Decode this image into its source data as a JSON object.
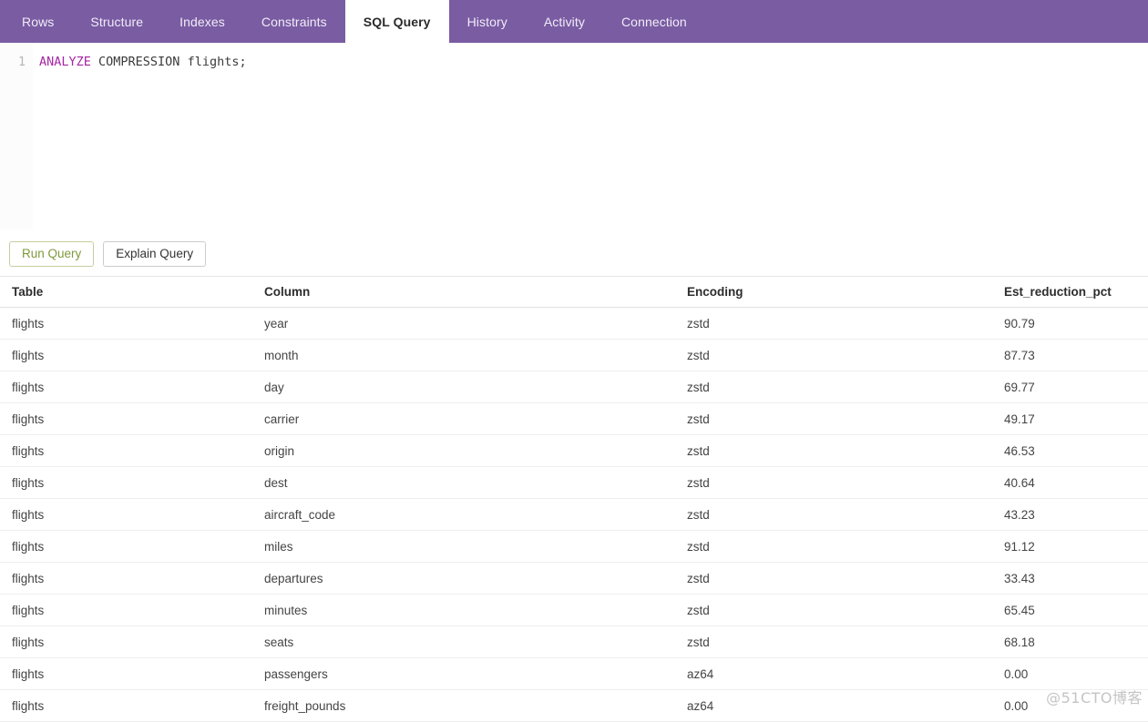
{
  "tabs": [
    {
      "label": "Rows",
      "active": false
    },
    {
      "label": "Structure",
      "active": false
    },
    {
      "label": "Indexes",
      "active": false
    },
    {
      "label": "Constraints",
      "active": false
    },
    {
      "label": "SQL Query",
      "active": true
    },
    {
      "label": "History",
      "active": false
    },
    {
      "label": "Activity",
      "active": false
    },
    {
      "label": "Connection",
      "active": false
    }
  ],
  "editor": {
    "line_number": "1",
    "keyword": "ANALYZE",
    "rest": " COMPRESSION flights;",
    "full_text": "ANALYZE COMPRESSION flights;"
  },
  "actions": {
    "run_label": "Run Query",
    "explain_label": "Explain Query"
  },
  "results": {
    "headers": [
      "Table",
      "Column",
      "Encoding",
      "Est_reduction_pct"
    ],
    "rows": [
      {
        "table": "flights",
        "column": "year",
        "encoding": "zstd",
        "est_reduction_pct": "90.79"
      },
      {
        "table": "flights",
        "column": "month",
        "encoding": "zstd",
        "est_reduction_pct": "87.73"
      },
      {
        "table": "flights",
        "column": "day",
        "encoding": "zstd",
        "est_reduction_pct": "69.77"
      },
      {
        "table": "flights",
        "column": "carrier",
        "encoding": "zstd",
        "est_reduction_pct": "49.17"
      },
      {
        "table": "flights",
        "column": "origin",
        "encoding": "zstd",
        "est_reduction_pct": "46.53"
      },
      {
        "table": "flights",
        "column": "dest",
        "encoding": "zstd",
        "est_reduction_pct": "40.64"
      },
      {
        "table": "flights",
        "column": "aircraft_code",
        "encoding": "zstd",
        "est_reduction_pct": "43.23"
      },
      {
        "table": "flights",
        "column": "miles",
        "encoding": "zstd",
        "est_reduction_pct": "91.12"
      },
      {
        "table": "flights",
        "column": "departures",
        "encoding": "zstd",
        "est_reduction_pct": "33.43"
      },
      {
        "table": "flights",
        "column": "minutes",
        "encoding": "zstd",
        "est_reduction_pct": "65.45"
      },
      {
        "table": "flights",
        "column": "seats",
        "encoding": "zstd",
        "est_reduction_pct": "68.18"
      },
      {
        "table": "flights",
        "column": "passengers",
        "encoding": "az64",
        "est_reduction_pct": "0.00"
      },
      {
        "table": "flights",
        "column": "freight_pounds",
        "encoding": "az64",
        "est_reduction_pct": "0.00"
      }
    ]
  },
  "watermark": {
    "text": "@51CTO博客"
  },
  "colors": {
    "tabbar_purple": "#7a5ca3",
    "active_tab_bg": "#ffffff",
    "run_button_text": "#7e9a3c",
    "run_button_border": "#c3cfa1",
    "keyword_purple": "#a626a4"
  }
}
